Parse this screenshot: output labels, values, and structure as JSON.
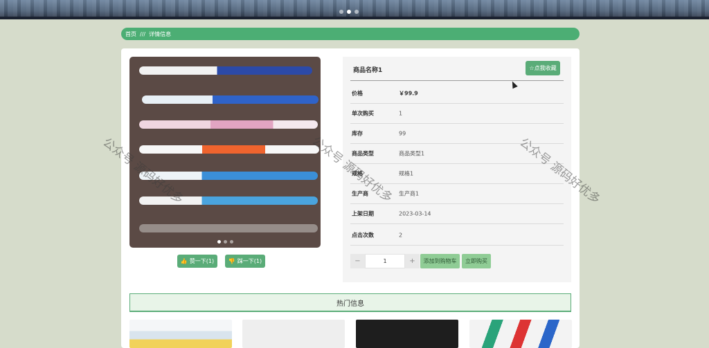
{
  "breadcrumb": {
    "home": "首页",
    "separator": "///",
    "current": "详情信息"
  },
  "product": {
    "title": "商品名称1",
    "favorite_label": "☆点我收藏",
    "fields": [
      {
        "label": "价格",
        "value": "￥99.9"
      },
      {
        "label": "单次购买",
        "value": "1"
      },
      {
        "label": "库存",
        "value": "99"
      },
      {
        "label": "商品类型",
        "value": "商品类型1"
      },
      {
        "label": "规格",
        "value": "规格1"
      },
      {
        "label": "生产商",
        "value": "生产商1"
      },
      {
        "label": "上架日期",
        "value": "2023-03-14"
      },
      {
        "label": "点击次数",
        "value": "2"
      }
    ],
    "quantity": "1",
    "minus": "−",
    "plus": "+",
    "add_to_cart": "添加到购物车",
    "buy_now": "立即购买"
  },
  "votes": {
    "like": {
      "icon": "👍",
      "label": "赞一下(1)"
    },
    "dislike": {
      "icon": "👎",
      "label": "踩一下(1)"
    }
  },
  "hot": {
    "title": "热门信息"
  },
  "watermark": "公众号 源码好优多",
  "colors": {
    "accent": "#5aac78",
    "breadcrumb": "#4cae74",
    "background": "#d6dccb"
  }
}
